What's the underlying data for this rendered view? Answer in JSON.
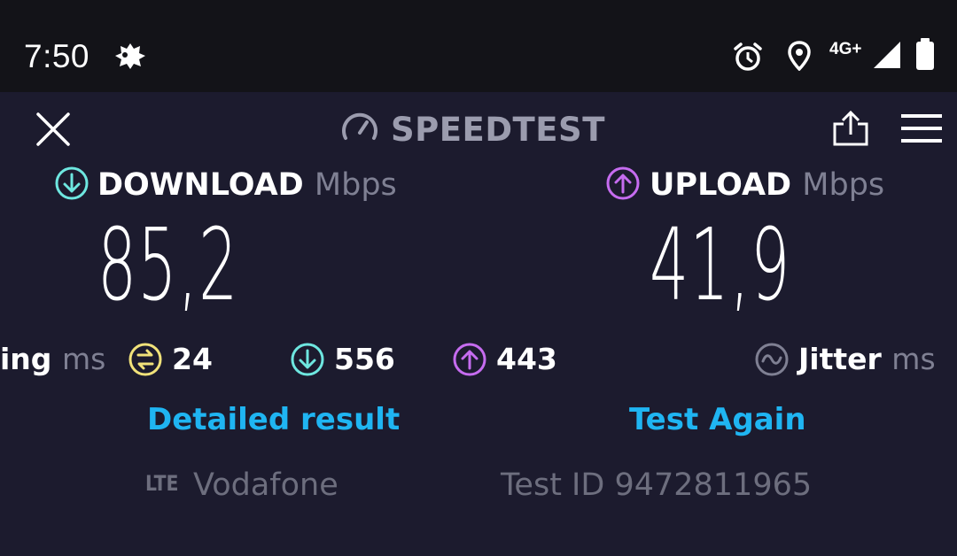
{
  "status_bar": {
    "time": "7:50",
    "network": "4G+",
    "icons": [
      "app-notification-icon",
      "alarm-icon",
      "location-icon",
      "signal-icon",
      "battery-icon"
    ]
  },
  "header": {
    "title": "SPEEDTEST",
    "close_icon": "close-icon",
    "share_icon": "share-icon",
    "menu_icon": "menu-icon"
  },
  "download": {
    "label": "DOWNLOAD",
    "unit": "Mbps",
    "value": "85,2"
  },
  "upload": {
    "label": "UPLOAD",
    "unit": "Mbps",
    "value": "41,9"
  },
  "metrics": {
    "ping_label": "ing",
    "ping_unit": "ms",
    "idle_ping": "24",
    "download_ping": "556",
    "upload_ping": "443",
    "jitter_label": "Jitter",
    "jitter_unit": "ms"
  },
  "actions": {
    "detailed_result": "Detailed result",
    "test_again": "Test Again"
  },
  "footer": {
    "connection_type": "LTE",
    "provider": "Vodafone",
    "test_id": "Test ID 9472811965"
  },
  "colors": {
    "background": "#1c1b2e",
    "download_accent": "#6ee7e0",
    "upload_accent": "#c66cf0",
    "ping_accent": "#f1e27a",
    "link": "#1fb5f2"
  }
}
